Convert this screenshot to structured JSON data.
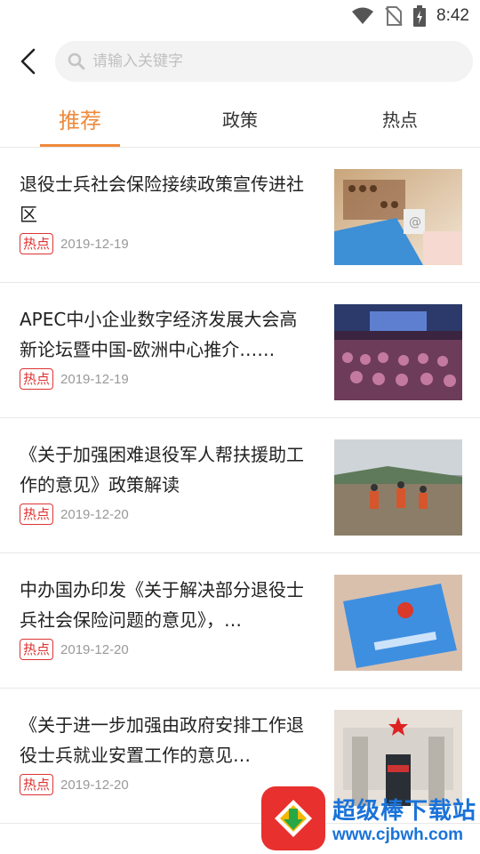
{
  "status_bar": {
    "time": "8:42"
  },
  "search": {
    "placeholder": "请输入关键字"
  },
  "tabs": [
    {
      "label": "推荐",
      "active": true
    },
    {
      "label": "政策",
      "active": false
    },
    {
      "label": "热点",
      "active": false
    }
  ],
  "news": [
    {
      "title": "退役士兵社会保险接续政策宣传进社区",
      "tag": "热点",
      "date": "2019-12-19",
      "image": "abacus-and-social-security-card"
    },
    {
      "title": "APEC中小企业数字经济发展大会高新论坛暨中国-欧洲中心推介……",
      "tag": "热点",
      "date": "2019-12-19",
      "image": "conference-hall"
    },
    {
      "title": "《关于加强困难退役军人帮扶援助工作的意见》政策解读",
      "tag": "热点",
      "date": "2019-12-20",
      "image": "flood-rescue"
    },
    {
      "title": "中办国办印发《关于解决部分退役士兵社会保险问题的意见》，…",
      "tag": "热点",
      "date": "2019-12-20",
      "image": "social-security-card"
    },
    {
      "title": "《关于进一步加强由政府安排工作退役士兵就业安置工作的意见…",
      "tag": "热点",
      "date": "2019-12-20",
      "image": "soldier-saluting-at-gate"
    }
  ],
  "watermark": {
    "name": "超级棒下载站",
    "url": "www.cjbwh.com"
  },
  "colors": {
    "accent": "#ee8a3c",
    "tag_red": "#dd3333",
    "watermark_blue": "#1a73d9"
  }
}
